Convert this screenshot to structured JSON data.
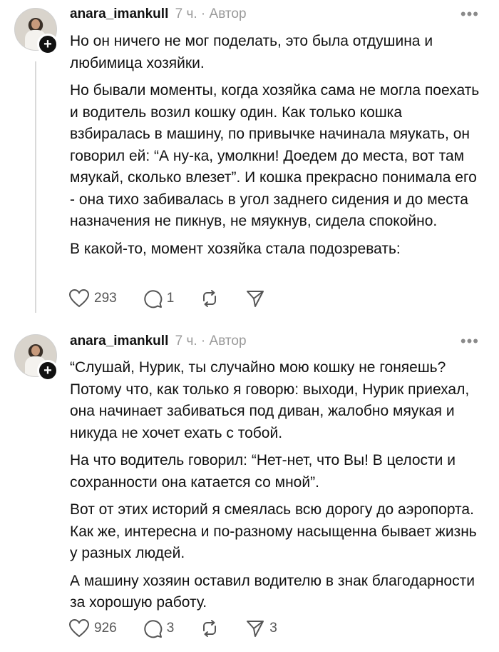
{
  "posts": [
    {
      "username": "anara_imankull",
      "meta": "7 ч. · Автор",
      "more_icon": "more-horizontal-icon",
      "paragraphs": [
        "Но он ничего не мог поделать,  это была отдушина и любимица хозяйки.",
        "Но бывали моменты,  когда хозяйка сама не могла поехать и водитель возил кошку один. Как только кошка взбиралась в машину, по привычке начинала мяукать, он говорил ей: “А ну-ка, умолкни!  Доедем до места,  вот там мяукай, сколько  влезет”. И кошка прекрасно понимала его - она тихо забивалась в угол заднего сидения и до места назначения не пикнув, не мяукнув, сидела спокойно.",
        "В какой-то, момент хозяйка  стала подозревать:"
      ],
      "likes": "293",
      "comments": "1",
      "shares": ""
    },
    {
      "username": "anara_imankull",
      "meta": "7 ч. · Автор",
      "more_icon": "more-horizontal-icon",
      "paragraphs": [
        "“Слушай, Нурик,  ты случайно мою кошку не гоняешь? Потому что,  как только я говорю: выходи, Нурик приехал, она  начинает забиваться под диван, жалобно мяукая и никуда не хочет ехать с тобой.",
        "На что водитель говорил: “Нет-нет, что Вы! В целости и сохранности  она катается со мной”.",
        "Вот от этих историй я смеялась всю дорогу до аэропорта. Как же, интересна и по-разному насыщенна бывает жизнь у разных людей.",
        "А машину хозяин оставил водителю в знак благодарности за хорошую работу."
      ],
      "likes": "926",
      "comments": "3",
      "shares": "3"
    }
  ],
  "colors": {
    "text": "#111111",
    "meta": "#9a9a9a",
    "icon": "#555555",
    "thread_line": "#d9d9d9"
  }
}
